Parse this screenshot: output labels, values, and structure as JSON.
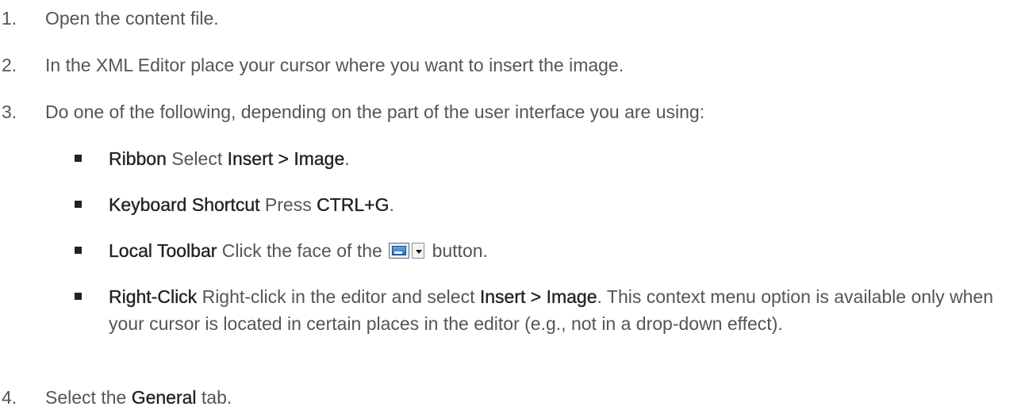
{
  "steps": [
    {
      "number": "1.",
      "text": "Open the content file."
    },
    {
      "number": "2.",
      "text": "In the XML Editor place your cursor where you want to insert the image."
    },
    {
      "number": "3.",
      "text": "Do one of the following, depending on the part of the user interface you are using:"
    },
    {
      "number": "4.",
      "prefix": "Select the ",
      "bold": "General",
      "suffix": " tab."
    }
  ],
  "options": [
    {
      "label": "Ribbon",
      "text_before": " Select ",
      "bold": "Insert > Image",
      "text_after": "."
    },
    {
      "label": "Keyboard Shortcut",
      "text_before": " Press ",
      "bold": "CTRL+G",
      "text_after": "."
    },
    {
      "label": "Local Toolbar",
      "text_before": " Click the face of the ",
      "icon": "insert-image-toolbar-icon",
      "text_after": " button."
    },
    {
      "label": "Right-Click",
      "text_before": " Right-click in the editor and select ",
      "bold": "Insert > Image",
      "text_after": ". This context menu option is available only when your cursor is located in certain places in the editor (e.g., not in a drop-down effect)."
    }
  ],
  "colors": {
    "text": "#555555",
    "emphasis": "#222222",
    "bullet": "#222222"
  }
}
